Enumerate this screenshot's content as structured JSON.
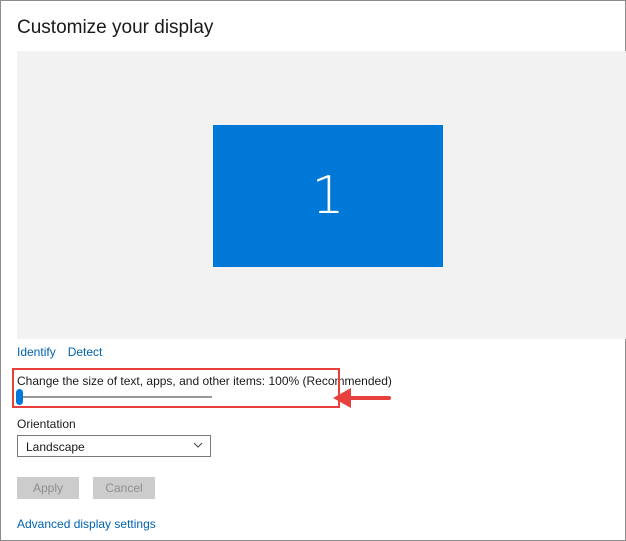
{
  "page": {
    "title": "Customize your display"
  },
  "preview": {
    "monitor_number": "1"
  },
  "links": {
    "identify": "Identify",
    "detect": "Detect",
    "advanced": "Advanced display settings"
  },
  "scale": {
    "label": "Change the size of text, apps, and other items: 100% (Recommended)",
    "slider_level": 0
  },
  "orientation": {
    "label": "Orientation",
    "selected": "Landscape"
  },
  "buttons": {
    "apply": "Apply",
    "cancel": "Cancel"
  },
  "colors": {
    "accent": "#0078d7",
    "link": "#0063b1",
    "annotation": "#e8413d",
    "disabled_button_bg": "#cccccc"
  }
}
